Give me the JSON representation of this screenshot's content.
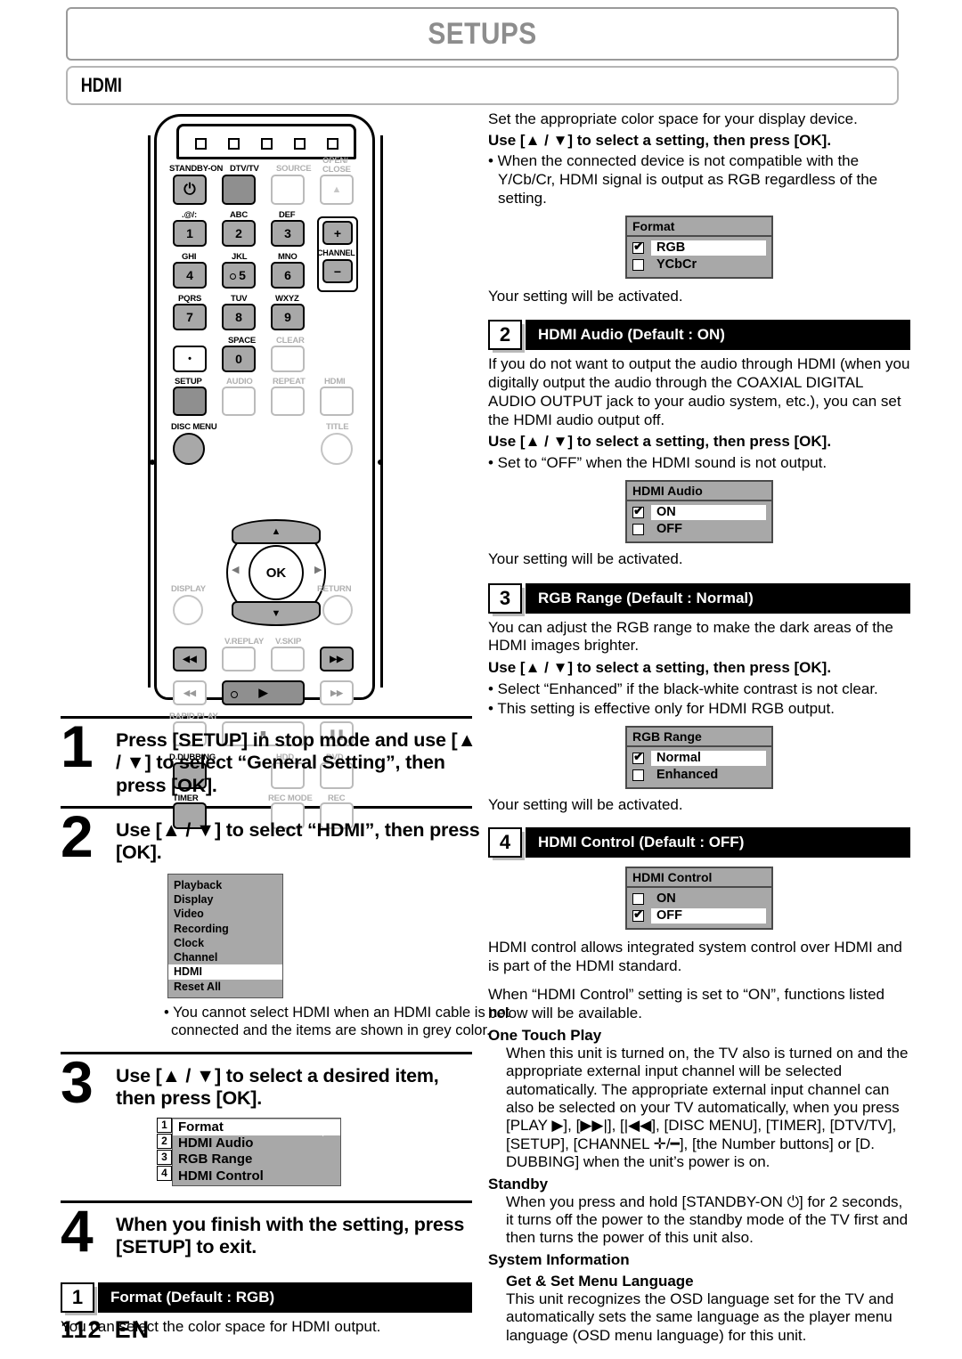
{
  "header": {
    "title": "SETUPS",
    "section": "HDMI"
  },
  "remote": {
    "top_buttons": [
      "STANDBY-ON",
      "DTV/TV",
      "SOURCE",
      "OPEN/CLOSE"
    ],
    "open_close_line1": "OPEN/",
    "open_close_line2": "CLOSE",
    "eject_glyph": "▲",
    "power_glyph": "⏻",
    "keypad": [
      {
        "letters": ".@/:",
        "digit": "1"
      },
      {
        "letters": "ABC",
        "digit": "2"
      },
      {
        "letters": "DEF",
        "digit": "3"
      },
      {
        "letters": "GHI",
        "digit": "4"
      },
      {
        "letters": "JKL",
        "digit": "5"
      },
      {
        "letters": "MNO",
        "digit": "6"
      },
      {
        "letters": "PQRS",
        "digit": "7"
      },
      {
        "letters": "TUV",
        "digit": "8"
      },
      {
        "letters": "WXYZ",
        "digit": "9"
      },
      {
        "letters": "",
        "digit": "•"
      },
      {
        "letters": "SPACE",
        "digit": "0"
      },
      {
        "letters": "CLEAR",
        "digit": ""
      }
    ],
    "channel": {
      "label": "CHANNEL",
      "plus": "+",
      "minus": "−"
    },
    "row_setup": [
      "SETUP",
      "AUDIO",
      "REPEAT",
      "HDMI"
    ],
    "disc_menu": "DISC MENU",
    "title_btn": "TITLE",
    "display_btn": "DISPLAY",
    "return_btn": "RETURN",
    "ok": "OK",
    "dpad": {
      "up": "▲",
      "down": "▼",
      "left": "◀",
      "right": "▶"
    },
    "skip_labels": [
      "V.REPLAY",
      "V.SKIP"
    ],
    "skip_prev": "◀◀",
    "skip_next": "▶▶",
    "rev": "◀◀",
    "fwd": "▶▶",
    "play": "▶",
    "stop": "■",
    "pause": "❚❚",
    "rapid_play": "RAPID PLAY",
    "d_dubbing": "D.DUBBING",
    "timer": "TIMER",
    "hdd": "HDD",
    "dvd": "DVD",
    "rec_mode": "REC MODE",
    "rec": "REC"
  },
  "steps": [
    {
      "num": "1",
      "text": "Press [SETUP] in stop mode and use [▲ / ▼] to select “General Setting”, then press [OK]."
    },
    {
      "num": "2",
      "text": "Use [▲ / ▼] to select “HDMI”, then press [OK].",
      "menu": [
        "Playback",
        "Display",
        "Video",
        "Recording",
        "Clock",
        "Channel",
        "HDMI",
        "Reset All"
      ],
      "menu_selected": "HDMI",
      "note": "• You cannot select HDMI when an HDMI cable is not connected and the items are shown in grey color."
    },
    {
      "num": "3",
      "text": "Use [▲ / ▼] to select a desired item, then press [OK].",
      "submenu": [
        {
          "n": "1",
          "label": "Format"
        },
        {
          "n": "2",
          "label": "HDMI Audio"
        },
        {
          "n": "3",
          "label": "RGB Range"
        },
        {
          "n": "4",
          "label": "HDMI Control"
        }
      ],
      "submenu_selected": "Format"
    },
    {
      "num": "4",
      "text": "When you finish with the setting, press [SETUP] to exit."
    }
  ],
  "sections": {
    "format": {
      "num": "1",
      "heading": "Format (Default : RGB)",
      "intro": "You can select the color space for HDMI output.",
      "desc": "Set the appropriate color space for your display device.",
      "instruction": "Use [▲ / ▼] to select a setting, then press [OK].",
      "bullet": "• When the connected device is not compatible with the Y/Cb/Cr, HDMI signal is output as RGB regardless of the setting.",
      "box_title": "Format",
      "options": [
        {
          "label": "RGB",
          "checked": true
        },
        {
          "label": "YCbCr",
          "checked": false
        }
      ],
      "activated": "Your setting will be activated."
    },
    "hdmi_audio": {
      "num": "2",
      "heading": "HDMI Audio (Default : ON)",
      "desc": "If you do not want to output the audio through HDMI (when you digitally output the audio through the COAXIAL DIGITAL AUDIO OUTPUT jack to your audio system, etc.), you can set the HDMI audio output off.",
      "instruction": "Use [▲ / ▼] to select a setting, then press [OK].",
      "bullet": "• Set to “OFF” when the HDMI sound is not output.",
      "box_title": "HDMI Audio",
      "options": [
        {
          "label": "ON",
          "checked": true
        },
        {
          "label": "OFF",
          "checked": false
        }
      ],
      "activated": "Your setting will be activated."
    },
    "rgb_range": {
      "num": "3",
      "heading": "RGB Range (Default : Normal)",
      "desc": "You can adjust the RGB range to make the dark areas of the HDMI images brighter.",
      "instruction": "Use [▲ / ▼] to select a setting, then press [OK].",
      "bullet1": "• Select “Enhanced” if the black-white contrast is not clear.",
      "bullet2": "• This setting is effective only for HDMI RGB output.",
      "box_title": "RGB Range",
      "options": [
        {
          "label": "Normal",
          "checked": true
        },
        {
          "label": "Enhanced",
          "checked": false
        }
      ],
      "activated": "Your setting will be activated."
    },
    "hdmi_control": {
      "num": "4",
      "heading": "HDMI Control (Default : OFF)",
      "box_title": "HDMI Control",
      "options": [
        {
          "label": "ON",
          "checked": false
        },
        {
          "label": "OFF",
          "checked": true
        }
      ],
      "desc1": "HDMI control allows integrated system control over HDMI and is part of the HDMI standard.",
      "desc2": "When “HDMI Control” setting is set to “ON”, functions listed below will be available.",
      "one_touch_play_head": "One Touch Play",
      "one_touch_play_body": "When this unit is turned on, the TV also is turned on and the appropriate external input channel will be selected automatically. The appropriate external input channel can also be selected on your TV automatically, when you press [PLAY ▶], [▶▶|], [|◀◀], [DISC MENU], [TIMER], [DTV/TV], [SETUP], [CHANNEL ✛/━], [the Number buttons] or [D. DUBBING] when the unit’s power is on.",
      "standby_head": "Standby",
      "standby_body": "When you press and hold [STANDBY-ON ⏻] for 2 seconds, it turns off the power to the standby mode of the TV first and then turns the power of this unit also.",
      "system_info_head": "System Information",
      "menu_lang_head": "Get & Set Menu Language",
      "menu_lang_body": "This unit recognizes the OSD language set for the TV and automatically sets the same language as the player menu language (OSD menu language) for this unit."
    }
  },
  "footer": {
    "page": "112",
    "lang": "EN"
  },
  "colors": {
    "osd_grey": "#a8a8a8",
    "header_grey": "#8d8d8d",
    "black": "#000000"
  }
}
